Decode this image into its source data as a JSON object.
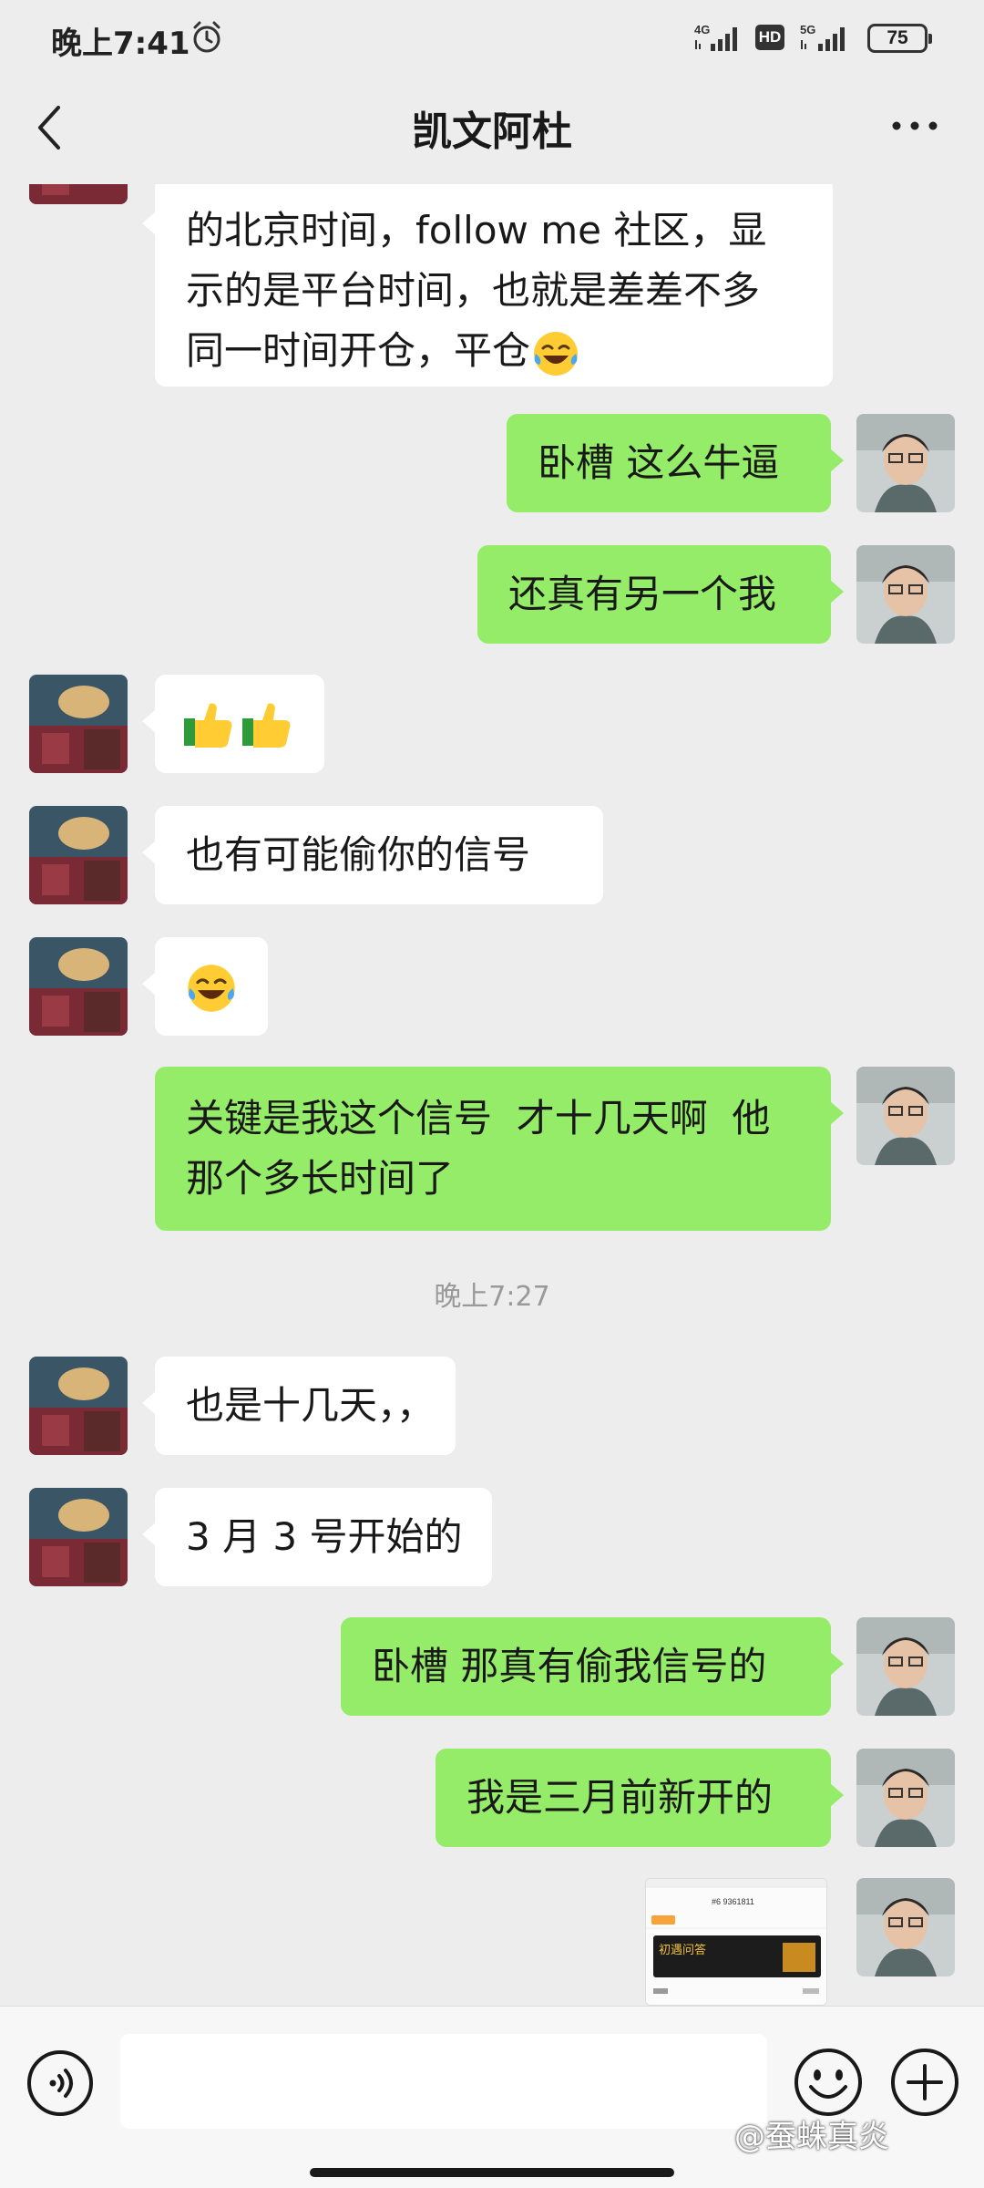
{
  "status_bar": {
    "time": "晚上7:41",
    "signal_1_label": "4G",
    "signal_2_label": "5G",
    "hd_label": "HD",
    "battery": "75"
  },
  "nav": {
    "title": "凯文阿杜"
  },
  "messages": [
    {
      "side": "in",
      "lines": [
        "的北京时间，follow me 社区，显",
        "示的是平台时间，也就是差差不多",
        "同一时间开仓，平仓"
      ],
      "trailing_emoji": "tears-of-joy"
    },
    {
      "side": "out",
      "text": "卧槽 这么牛逼"
    },
    {
      "side": "out",
      "text": "还真有另一个我"
    },
    {
      "side": "in",
      "emoji": "thumbs-up thumbs-up"
    },
    {
      "side": "in",
      "text": "也有可能偷你的信号"
    },
    {
      "side": "in",
      "emoji": "tears-of-joy"
    },
    {
      "side": "out",
      "lines": [
        "关键是我这个信号  才十几天啊  他",
        "那个多长时间了"
      ]
    },
    {
      "side": "in",
      "text": "也是十几天，，"
    },
    {
      "side": "in",
      "text": "3 月 3 号开始的"
    },
    {
      "side": "out",
      "text": "卧槽 那真有偷我信号的"
    },
    {
      "side": "out",
      "text": "我是三月前新开的"
    }
  ],
  "time_separator": "晚上7:27",
  "image_message": {
    "account_line": "#6 9361811",
    "banner_text": "初遇问答"
  },
  "watermark": "@蚕蛛真炎",
  "colors": {
    "background": "#ededed",
    "outgoing_bubble": "#95ec69",
    "incoming_bubble": "#ffffff"
  }
}
